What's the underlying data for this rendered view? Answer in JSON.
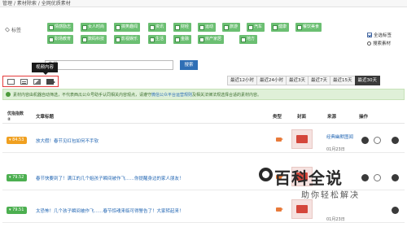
{
  "breadcrumb": {
    "items": [
      "管理",
      "素材除索",
      "全网优质素材"
    ],
    "separator": " / "
  },
  "filter": {
    "label": "标签",
    "tags": [
      "情感励志",
      "女人时尚",
      "搞笑趣闻",
      "资讯",
      "财经",
      "运动",
      "旅游",
      "汽车",
      "健康",
      "餐饮美食",
      "职场教育",
      "数码科技",
      "影视娱乐",
      "生活",
      "金融",
      "房产家居",
      "地方"
    ],
    "options": [
      {
        "label": "全选标签",
        "checked": true
      },
      {
        "label": "搜索素材",
        "icon": "search-icon"
      }
    ],
    "search_value": "春节",
    "search_button": "搜索"
  },
  "tooltip": "视频内容",
  "view_icons": [
    "list-icon",
    "document-icon",
    "image-icon",
    "video-icon"
  ],
  "range_tabs": [
    "最近12小时",
    "最近24小时",
    "最近3天",
    "最近7天",
    "最近15天",
    "最近30天"
  ],
  "active_range": "最近30天",
  "notice": {
    "text": "素材内容由机器自动筛选，不代表西瓜公众号助手认同相关内容观点，请遵守",
    "link": "微信公众平台运营规则",
    "suffix": "及相关法律法规选择合适的素材内容。"
  },
  "table": {
    "headers": {
      "index_line1": "优指指数",
      "index_line2": "②",
      "title": "文章标题",
      "type": "类型",
      "cover": "封面",
      "source": "来源",
      "actions": "操作"
    },
    "rows": [
      {
        "score": "84.53",
        "score_color": "#f0a020",
        "title": "放大假！春节见红包如何不手软",
        "source": "经典幽默图闻",
        "date": "01月23日"
      },
      {
        "score": "79.52",
        "score_color": "#4caf50",
        "title": "春节快要到了！满江的几个姐孩子瞬间被作飞……你提醒身边的家人朋友！",
        "source": "",
        "date": "01月23日"
      },
      {
        "score": "79.51",
        "score_color": "#4caf50",
        "title": "太恐怖！几个孩子瞬间被作飞……春节惊魂来临可得警告了！大家转起来！",
        "source": "",
        "date": "01月23日"
      }
    ]
  },
  "watermark": {
    "main": "百科全说",
    "sub": "助你轻松解决"
  }
}
